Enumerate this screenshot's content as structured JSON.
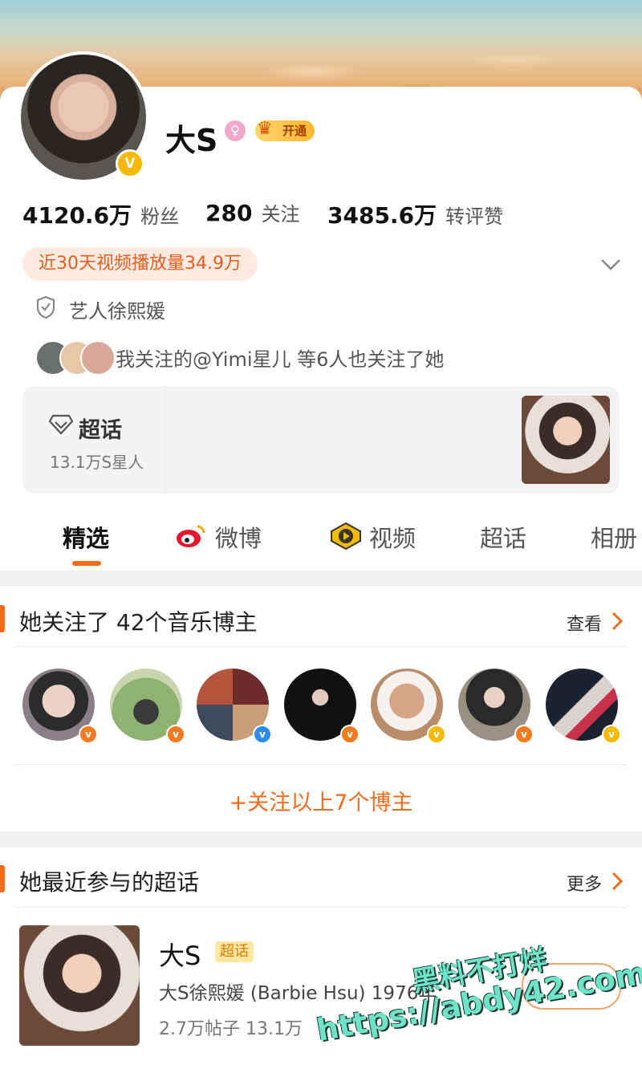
{
  "profile": {
    "name": "大S",
    "vip_label": "开通",
    "gender_icon": "female-icon",
    "stats": [
      {
        "value": "4120.6万",
        "label": "粉丝"
      },
      {
        "value": "280",
        "label": "关注"
      },
      {
        "value": "3485.6万",
        "label": "转评赞"
      }
    ],
    "video_views": "近30天视频播放量34.9万",
    "verification": "艺人徐熙媛",
    "mutual_follow": "我关注的@Yimi星儿 等6人也关注了她"
  },
  "supertopic_card": {
    "title": "超话",
    "subtitle": "13.1万S星人"
  },
  "tabs": [
    {
      "label": "精选",
      "icon": ""
    },
    {
      "label": "微博",
      "icon": "weibo-icon"
    },
    {
      "label": "视频",
      "icon": "video-icon"
    },
    {
      "label": "超话",
      "icon": ""
    },
    {
      "label": "相册",
      "icon": ""
    }
  ],
  "music_section": {
    "title": "她关注了 42个音乐博主",
    "action": "查看",
    "follow_all": "+关注以上7个博主",
    "bloggers": [
      {
        "badge": "orange"
      },
      {
        "badge": "orange"
      },
      {
        "badge": "blue"
      },
      {
        "badge": "orange"
      },
      {
        "badge": "yellow"
      },
      {
        "badge": "orange"
      },
      {
        "badge": "yellow"
      }
    ]
  },
  "recent_supertopic": {
    "title": "她最近参与的超话",
    "action": "更多",
    "item": {
      "name": "大S",
      "tag": "超话",
      "desc": "大S徐熙媛 (Barbie Hsu) 1976年",
      "stats": "2.7万帖子 13.1万"
    }
  },
  "watermark": {
    "line1": "黑料不打烊",
    "line2": "https://abdy42.com"
  },
  "colors": {
    "accent": "#f46b1c",
    "verified_gold": "#f6b800",
    "verified_blue": "#2d8cf0"
  }
}
